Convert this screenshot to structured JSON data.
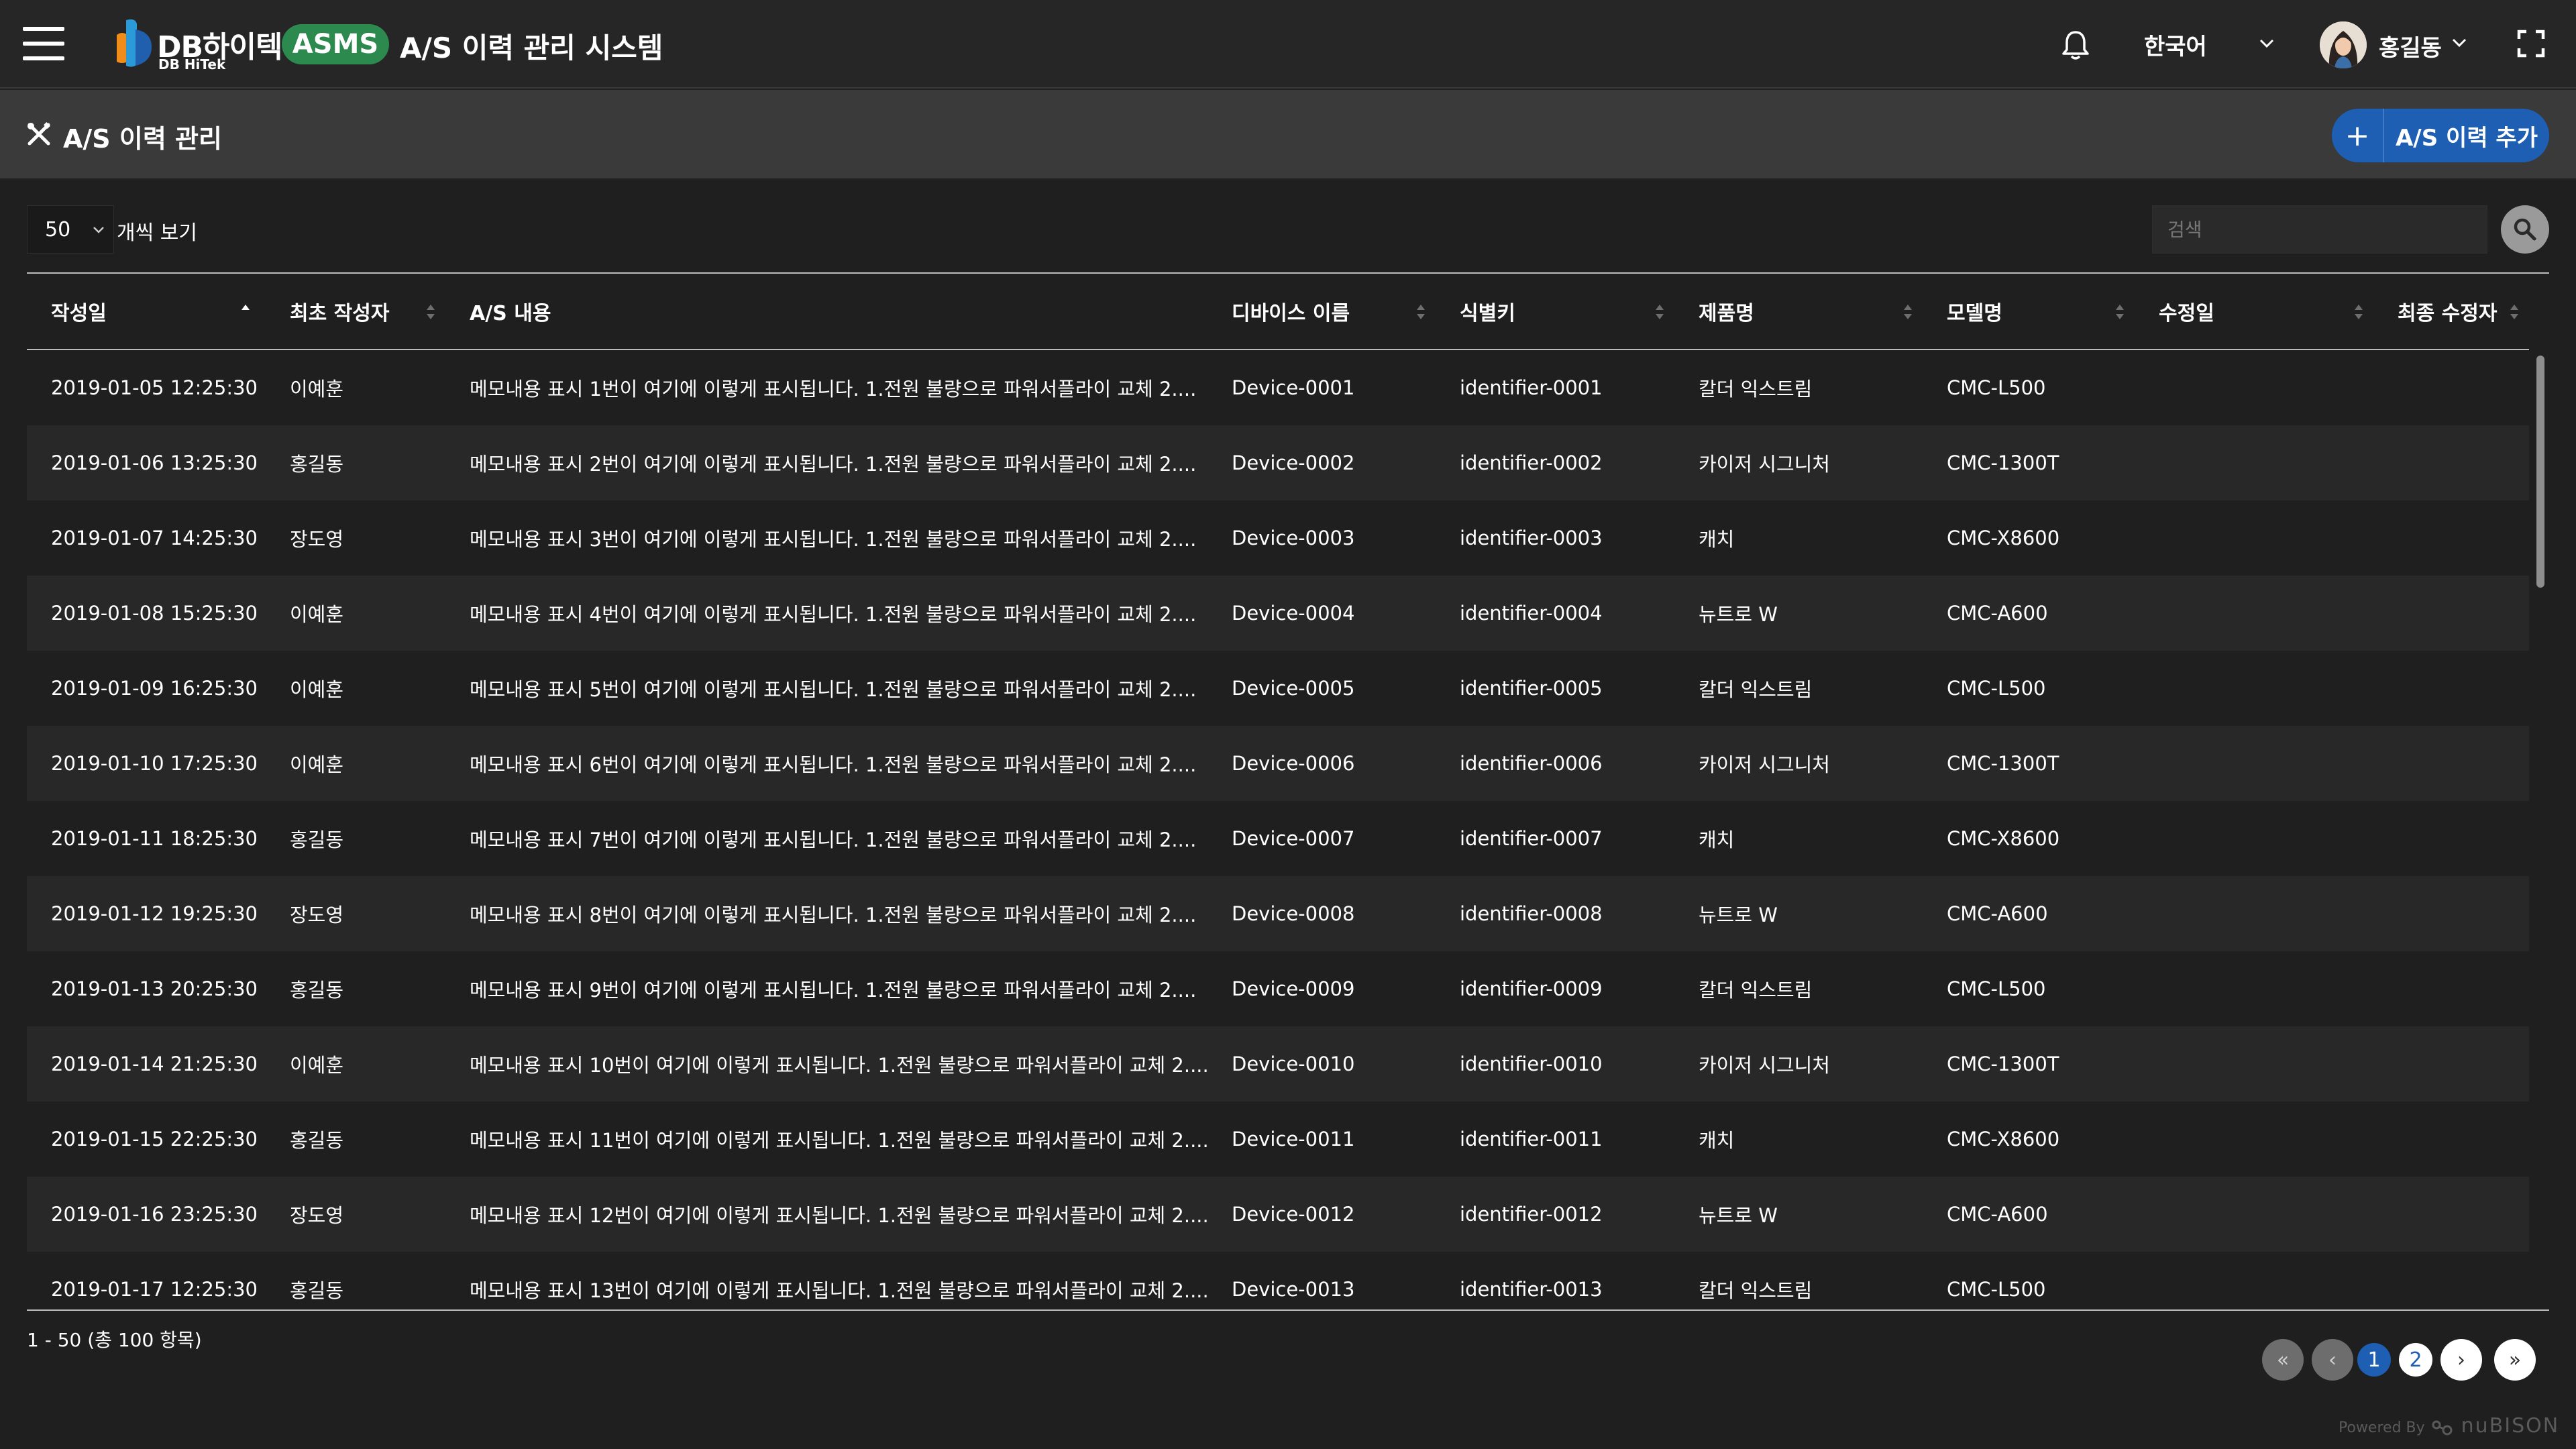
{
  "header": {
    "brand_ko": "DB하이텍",
    "brand_en": "DB HiTek",
    "badge": "ASMS",
    "system_title": "A/S 이력 관리 시스템",
    "language": "한국어",
    "user_name": "홍길동"
  },
  "page": {
    "title": "A/S 이력 관리",
    "add_button_label": "A/S 이력 추가",
    "add_button_icon": "+"
  },
  "controls": {
    "page_size": "50",
    "page_size_label": "개씩 보기",
    "search_placeholder": "검색"
  },
  "table": {
    "columns": [
      {
        "label": "작성일",
        "sort": "asc"
      },
      {
        "label": "최초 작성자",
        "sort": "none"
      },
      {
        "label": "A/S 내용",
        "sort": null
      },
      {
        "label": "디바이스 이름",
        "sort": "none"
      },
      {
        "label": "식별키",
        "sort": "none"
      },
      {
        "label": "제품명",
        "sort": "none"
      },
      {
        "label": "모델명",
        "sort": "none"
      },
      {
        "label": "수정일",
        "sort": "none"
      },
      {
        "label": "최종 수정자",
        "sort": "none"
      }
    ],
    "rows": [
      [
        "2019-01-05 12:25:30",
        "이예훈",
        "메모내용 표시 1번이 여기에 이렇게 표시됩니다. 1.전원 불량으로 파워서플라이 교체 2....",
        "Device-0001",
        "identifier-0001",
        "칼더 익스트림",
        "CMC-L500",
        "",
        ""
      ],
      [
        "2019-01-06 13:25:30",
        "홍길동",
        "메모내용 표시 2번이 여기에 이렇게 표시됩니다. 1.전원 불량으로 파워서플라이 교체 2....",
        "Device-0002",
        "identifier-0002",
        "카이저 시그니처",
        "CMC-1300T",
        "",
        ""
      ],
      [
        "2019-01-07 14:25:30",
        "장도영",
        "메모내용 표시 3번이 여기에 이렇게 표시됩니다. 1.전원 불량으로 파워서플라이 교체 2....",
        "Device-0003",
        "identifier-0003",
        "캐치",
        "CMC-X8600",
        "",
        ""
      ],
      [
        "2019-01-08 15:25:30",
        "이예훈",
        "메모내용 표시 4번이 여기에 이렇게 표시됩니다. 1.전원 불량으로 파워서플라이 교체 2....",
        "Device-0004",
        "identifier-0004",
        "뉴트로 W",
        "CMC-A600",
        "",
        ""
      ],
      [
        "2019-01-09 16:25:30",
        "이예훈",
        "메모내용 표시 5번이 여기에 이렇게 표시됩니다. 1.전원 불량으로 파워서플라이 교체 2....",
        "Device-0005",
        "identifier-0005",
        "칼더 익스트림",
        "CMC-L500",
        "",
        ""
      ],
      [
        "2019-01-10 17:25:30",
        "이예훈",
        "메모내용 표시 6번이 여기에 이렇게 표시됩니다. 1.전원 불량으로 파워서플라이 교체 2....",
        "Device-0006",
        "identifier-0006",
        "카이저 시그니처",
        "CMC-1300T",
        "",
        ""
      ],
      [
        "2019-01-11 18:25:30",
        "홍길동",
        "메모내용 표시 7번이 여기에 이렇게 표시됩니다. 1.전원 불량으로 파워서플라이 교체 2....",
        "Device-0007",
        "identifier-0007",
        "캐치",
        "CMC-X8600",
        "",
        ""
      ],
      [
        "2019-01-12 19:25:30",
        "장도영",
        "메모내용 표시 8번이 여기에 이렇게 표시됩니다. 1.전원 불량으로 파워서플라이 교체 2....",
        "Device-0008",
        "identifier-0008",
        "뉴트로 W",
        "CMC-A600",
        "",
        ""
      ],
      [
        "2019-01-13 20:25:30",
        "홍길동",
        "메모내용 표시 9번이 여기에 이렇게 표시됩니다. 1.전원 불량으로 파워서플라이 교체 2....",
        "Device-0009",
        "identifier-0009",
        "칼더 익스트림",
        "CMC-L500",
        "",
        ""
      ],
      [
        "2019-01-14 21:25:30",
        "이예훈",
        "메모내용 표시 10번이 여기에 이렇게 표시됩니다. 1.전원 불량으로 파워서플라이 교체 2....",
        "Device-0010",
        "identifier-0010",
        "카이저 시그니처",
        "CMC-1300T",
        "",
        ""
      ],
      [
        "2019-01-15 22:25:30",
        "홍길동",
        "메모내용 표시 11번이 여기에 이렇게 표시됩니다. 1.전원 불량으로 파워서플라이 교체 2....",
        "Device-0011",
        "identifier-0011",
        "캐치",
        "CMC-X8600",
        "",
        ""
      ],
      [
        "2019-01-16 23:25:30",
        "장도영",
        "메모내용 표시 12번이 여기에 이렇게 표시됩니다. 1.전원 불량으로 파워서플라이 교체 2....",
        "Device-0012",
        "identifier-0012",
        "뉴트로 W",
        "CMC-A600",
        "",
        ""
      ],
      [
        "2019-01-17 12:25:30",
        "홍길동",
        "메모내용 표시 13번이 여기에 이렇게 표시됩니다. 1.전원 불량으로 파워서플라이 교체 2....",
        "Device-0013",
        "identifier-0013",
        "칼더 익스트림",
        "CMC-L500",
        "",
        ""
      ]
    ]
  },
  "footer": {
    "summary": "1 - 50 (총 100 항목)",
    "pagination": {
      "first": "«",
      "prev": "‹",
      "pages": [
        "1",
        "2"
      ],
      "current": "1",
      "next": "›",
      "last": "»"
    },
    "powered_by_label": "Powered By",
    "powered_by_brand": "nuBISON"
  },
  "colors": {
    "accent": "#1e5fb4",
    "badge": "#2c8a4f",
    "background": "#1f1f1f",
    "topbar": "#262626",
    "page_header": "#3a3a3a",
    "row_alt": "#282828"
  },
  "icons": {
    "menu": "hamburger-icon",
    "notifications": "bell-icon",
    "language_dropdown": "chevron-down-icon",
    "user_dropdown": "chevron-down-icon",
    "fullscreen": "fullscreen-icon",
    "page": "tools-icon",
    "search": "search-icon"
  }
}
